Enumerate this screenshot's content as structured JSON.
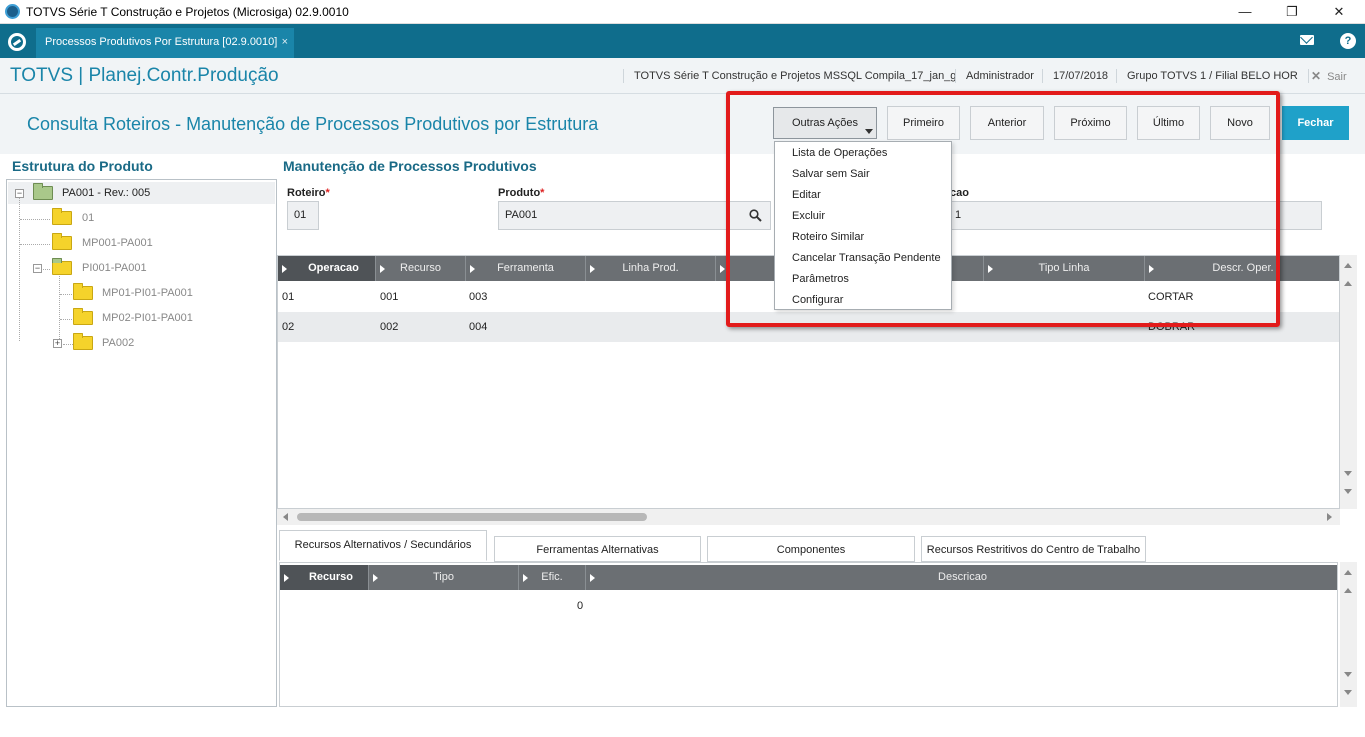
{
  "window": {
    "title": "TOTVS Série T Construção e Projetos (Microsiga) 02.9.0010",
    "minimize": "—",
    "restore": "❐",
    "close": "✕"
  },
  "tabbar": {
    "tab_label": "Processos Produtivos Por Estrutura [02.9.0010]",
    "tab_close": "×",
    "help": "?"
  },
  "module_header": {
    "module_name": "TOTVS | Planej.Contr.Produção",
    "environment": "TOTVS Série T Construção e Projetos MSSQL Compila_17_jan_g",
    "user": "Administrador",
    "date": "17/07/2018",
    "company": "Grupo TOTVS 1 / Filial BELO HOR",
    "exit_icon": "✕",
    "exit_label": "Sair"
  },
  "page": {
    "title": "Consulta Roteiros - Manutenção de Processos Produtivos por Estrutura"
  },
  "toolbar": {
    "outras_acoes": "Outras Ações",
    "primeiro": "Primeiro",
    "anterior": "Anterior",
    "proximo": "Próximo",
    "ultimo": "Último",
    "novo": "Novo",
    "fechar": "Fechar"
  },
  "dropdown_items": [
    "Lista de Operações",
    "Salvar sem Sair",
    "Editar",
    "Excluir",
    "Roteiro Similar",
    "Cancelar Transação Pendente",
    "Parâmetros",
    "Configurar"
  ],
  "tree": {
    "title": "Estrutura do Produto",
    "toggle_minus": "−",
    "toggle_plus": "+",
    "nodes": [
      {
        "label": "PA001 - Rev.: 005"
      },
      {
        "label": "01"
      },
      {
        "label": "MP001-PA001"
      },
      {
        "label": "PI001-PA001"
      },
      {
        "label": "MP01-PI01-PA001"
      },
      {
        "label": "MP02-PI01-PA001"
      },
      {
        "label": "PA002"
      }
    ]
  },
  "maint": {
    "title": "Manutenção de Processos Produtivos",
    "roteiro_label": "Roteiro",
    "roteiro_value": "01",
    "produto_label": "Produto",
    "produto_value": "PA001",
    "required_mark": "*",
    "descricao_label_partial": "cao",
    "descricao_value_partial": "1"
  },
  "ops_grid": {
    "columns": [
      "Operacao",
      "Recurso",
      "Ferramenta",
      "Linha Prod.",
      "Tipo Linha",
      "Descr. Oper."
    ],
    "rows": [
      {
        "operacao": "01",
        "recurso": "001",
        "ferramenta": "003",
        "descr": "CORTAR"
      },
      {
        "operacao": "02",
        "recurso": "002",
        "ferramenta": "004",
        "descr": "DOBRAR"
      }
    ]
  },
  "subtabs": [
    "Recursos Alternativos / Secundários",
    "Ferramentas Alternativas",
    "Componentes",
    "Recursos Restritivos do Centro de Trabalho"
  ],
  "alt_grid": {
    "columns": [
      "Recurso",
      "Tipo",
      "Efic.",
      "Descricao"
    ],
    "rows": [
      {
        "efic": "0"
      }
    ]
  },
  "colors": {
    "brand_teal": "#0f6d8c",
    "accent_blue": "#1a85a9",
    "fechar_blue": "#1fa1c9",
    "highlight_red": "#e21b1b",
    "grid_header": "#6b6f73"
  }
}
